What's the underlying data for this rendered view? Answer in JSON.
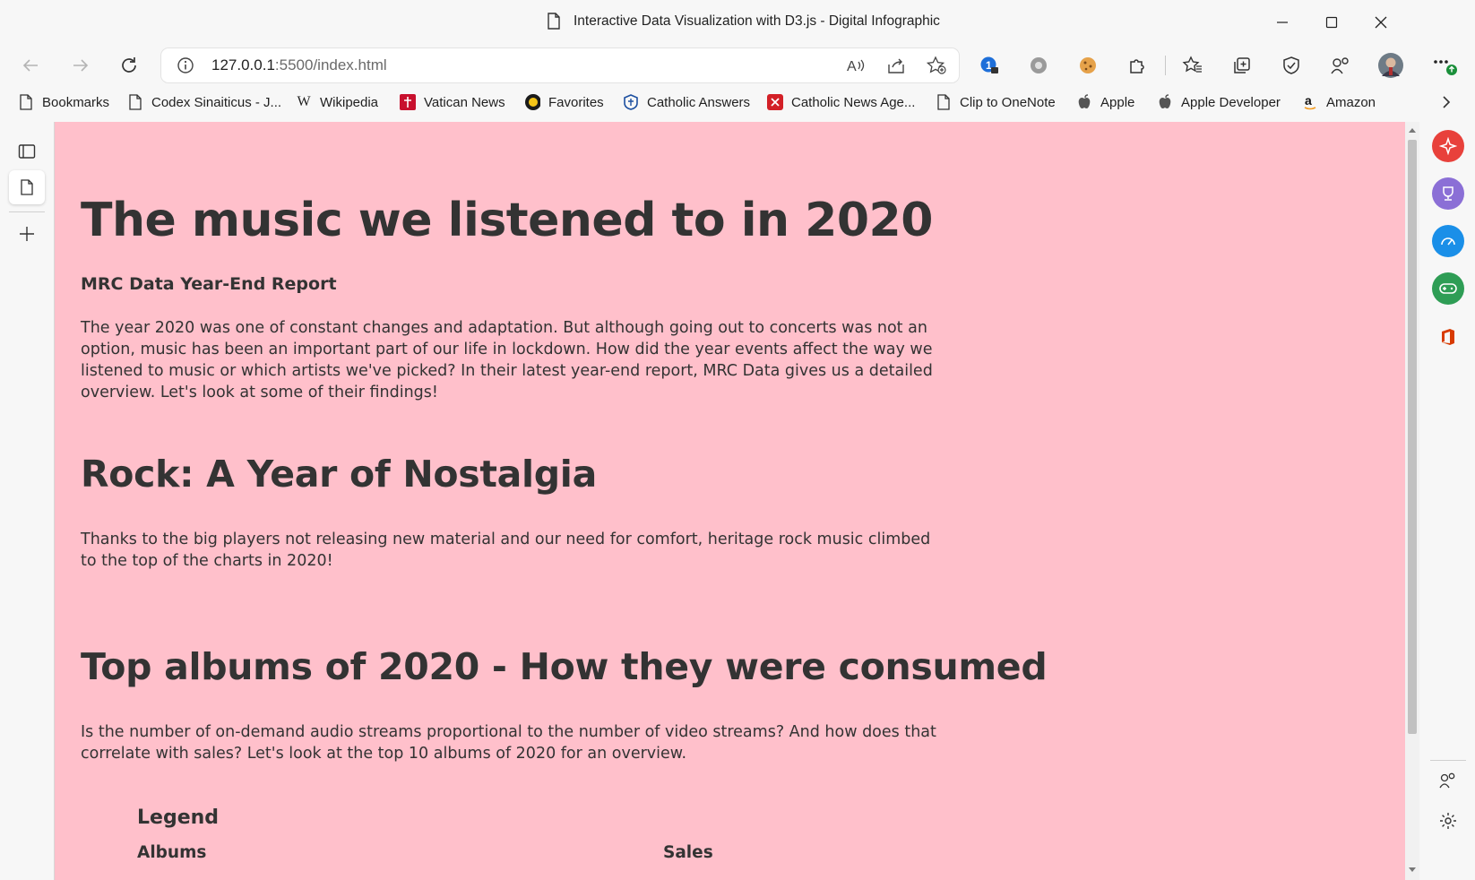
{
  "window": {
    "title": "Interactive Data Visualization with D3.js - Digital Infographic"
  },
  "address": {
    "url_host": "127.0.0.1",
    "url_rest": ":5500/index.html"
  },
  "bookmarks": [
    {
      "label": "Bookmarks",
      "icon": "page-icon"
    },
    {
      "label": "Codex Sinaiticus - J...",
      "icon": "page-icon"
    },
    {
      "label": "Wikipedia",
      "icon": "wikipedia-icon"
    },
    {
      "label": "Vatican News",
      "icon": "vatican-news-icon"
    },
    {
      "label": "Favorites",
      "icon": "favorites-icon"
    },
    {
      "label": "Catholic Answers",
      "icon": "catholic-answers-icon"
    },
    {
      "label": "Catholic News Age...",
      "icon": "catholic-news-icon"
    },
    {
      "label": "Clip to OneNote",
      "icon": "page-icon"
    },
    {
      "label": "Apple",
      "icon": "apple-icon"
    },
    {
      "label": "Apple Developer",
      "icon": "apple-icon"
    },
    {
      "label": "Amazon",
      "icon": "amazon-icon"
    }
  ],
  "page": {
    "heading": "The music we listened to in 2020",
    "subheading": "MRC Data Year-End Report",
    "intro": "The year 2020 was one of constant changes and adaptation. But although going out to concerts was not an option, music has been an important part of our life in lockdown. How did the year events affect the way we listened to music or which artists we've picked? In their latest year-end report, MRC Data gives us a detailed overview. Let's look at some of their findings!",
    "rock_heading": "Rock: A Year of Nostalgia",
    "rock_text": "Thanks to the big players not releasing new material and our need for comfort, heritage rock music climbed to the top of the charts in 2020!",
    "albums_heading": "Top albums of 2020 - How they were consumed",
    "albums_text": "Is the number of on-demand audio streams proportional to the number of video streams? And how does that correlate with sales? Let's look at the top 10 albums of 2020 for an overview.",
    "legend_title": "Legend",
    "legend_albums": "Albums",
    "legend_sales": "Sales"
  },
  "colors": {
    "page_bg": "#ffc0cb",
    "text": "#333333",
    "chrome_bg": "#f7f7f7"
  }
}
